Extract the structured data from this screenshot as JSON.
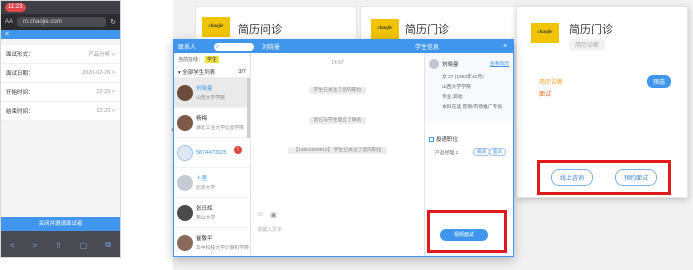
{
  "phone": {
    "time": "11:23",
    "aa": "AA",
    "url": "m.chaojie.com",
    "back": "<",
    "rows": [
      {
        "label": "面试形式：",
        "value": "产品分析 >"
      },
      {
        "label": "面试日期：",
        "value": "2020-02-26 >"
      },
      {
        "label": "开始时间：",
        "value": "23:23 >"
      },
      {
        "label": "结束时间：",
        "value": "23:23 >"
      }
    ],
    "submit_label": "关闭并邀请面试者",
    "bottom_icons": [
      "<",
      ">",
      "⇧",
      "▢",
      "⧉"
    ]
  },
  "cards": [
    {
      "title": "简历问诊",
      "logo": "chaojie"
    },
    {
      "title": "简历门诊",
      "logo": "chaojie"
    },
    {
      "title": "简历门诊",
      "logo": "chaojie",
      "sub": "简历诊断",
      "link": "简历诊断",
      "unread": "面试",
      "notify": "预选",
      "btn_left": "线上咨询",
      "btn_right": "预约面试"
    }
  ],
  "chat": {
    "header": {
      "contacts": "联系人",
      "peer": "刘晓曼",
      "info": "学生信息",
      "close": "×"
    },
    "list": {
      "top_prefix": "当前在线：",
      "highlight": "学生",
      "section_label": "▾ 全部学生列表",
      "section_count": "3/7",
      "more": "⌄",
      "items": [
        {
          "name": "刘晓曼",
          "desc": "山西大学学院",
          "active": true
        },
        {
          "name": "杨梅",
          "desc": "湖北工业大学信息学院",
          "active": false
        },
        {
          "name": "5874473925",
          "desc": "",
          "active": false,
          "badge": "!"
        },
        {
          "name": "卜里",
          "desc": "北京大学",
          "active": false
        },
        {
          "name": "张日辉",
          "desc": "燕山大学",
          "active": false
        },
        {
          "name": "崔敬平",
          "desc": "华中科技大学计算机学院",
          "active": false
        }
      ]
    },
    "conv": {
      "time": "14:57",
      "sys_msgs": [
        "学生已关注了您的职位",
        "您已与学生建立了联系",
        "【13602889812】 学生已关注了您的职位"
      ],
      "tools": [
        "☺",
        "▣"
      ],
      "input_placeholder": "请输入文字"
    },
    "info": {
      "name": "刘晓曼",
      "link": "查看简历",
      "lines": [
        "女 27 (1993年10月)",
        "山西大学学院",
        "专业:其他",
        "本科在读 营销/市场推广专员"
      ],
      "section": "投递职位",
      "job": "产品经理 2",
      "tags": [
        "邀请",
        "面试"
      ],
      "video_btn": "视频面试"
    }
  },
  "accent": "#3f96ec",
  "highlight_red": "#e0191c"
}
